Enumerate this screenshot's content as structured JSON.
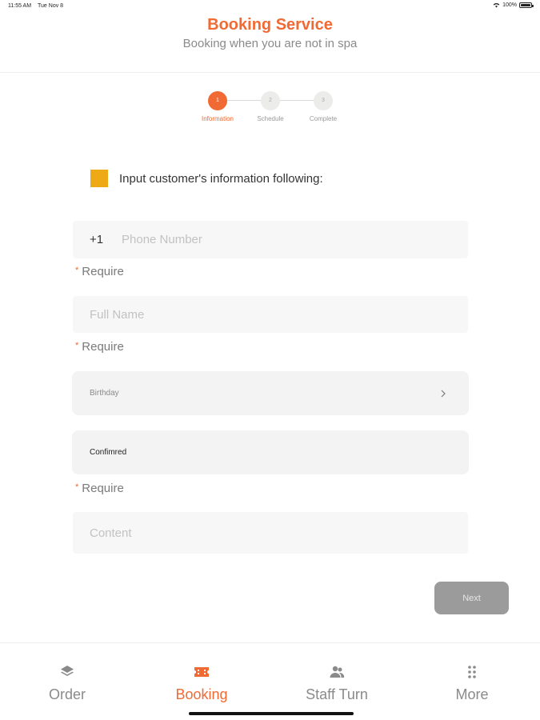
{
  "status_bar": {
    "time": "11:55 AM",
    "date": "Tue Nov 8",
    "battery": "100%"
  },
  "header": {
    "title": "Booking Service",
    "subtitle": "Booking when you are not in spa"
  },
  "stepper": {
    "steps": [
      {
        "number": "1",
        "label": "Information"
      },
      {
        "number": "2",
        "label": "Schedule"
      },
      {
        "number": "3",
        "label": "Complete"
      }
    ],
    "active_step": 1
  },
  "form": {
    "heading": "Input customer's information following:",
    "phone": {
      "prefix": "+1",
      "placeholder": "Phone Number"
    },
    "full_name": {
      "placeholder": "Full Name"
    },
    "birthday": {
      "label": "Birthday"
    },
    "status": {
      "label": "Confimred"
    },
    "content": {
      "placeholder": "Content"
    },
    "require_mark": "*",
    "require_text": "Require"
  },
  "next_button": {
    "label": "Next"
  },
  "tab_bar": {
    "tabs": [
      {
        "label": "Order",
        "icon": "layers-icon"
      },
      {
        "label": "Booking",
        "icon": "ticket-icon"
      },
      {
        "label": "Staff Turn",
        "icon": "people-icon"
      },
      {
        "label": "More",
        "icon": "dots-grid-icon"
      }
    ],
    "active_tab": 1
  },
  "colors": {
    "accent": "#f26a33",
    "section_marker": "#eeaa14",
    "disabled_button": "#9b9b9b",
    "field_background": "#f7f7f7"
  }
}
